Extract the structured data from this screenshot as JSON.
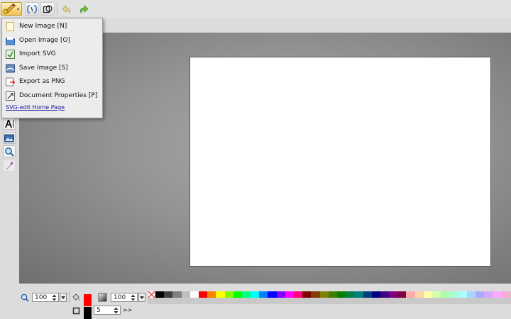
{
  "menu": {
    "items": [
      {
        "label": "New Image [N]",
        "icon": "new-image-icon"
      },
      {
        "label": "Open Image [O]",
        "icon": "open-image-icon"
      },
      {
        "label": "Import SVG",
        "icon": "import-svg-icon"
      },
      {
        "label": "Save Image [S]",
        "icon": "save-image-icon"
      },
      {
        "label": "Export as PNG",
        "icon": "export-png-icon"
      },
      {
        "label": "Document Properties [P]",
        "icon": "document-properties-icon"
      }
    ],
    "home_link": "SVG-edit Home Page"
  },
  "toolbar": {
    "icons": [
      "main-menu-icon",
      "source-icon",
      "wireframe-icon",
      "undo-icon",
      "redo-icon"
    ]
  },
  "bottom": {
    "zoom_value": "100",
    "opacity_value": "100",
    "stroke_width_value": "5",
    "more_label": ">>",
    "fill_color": "#ff0000",
    "stroke_color": "#000000"
  },
  "palette": [
    "#000000",
    "#3f3f3f",
    "#7f7f7f",
    "#bfbfbf",
    "#ffffff",
    "#ff0000",
    "#ff7f00",
    "#ffff00",
    "#7fff00",
    "#00ff00",
    "#00ff7f",
    "#00ffff",
    "#007fff",
    "#0000ff",
    "#7f00ff",
    "#ff00ff",
    "#ff007f",
    "#7f0000",
    "#7f3f00",
    "#7f7f00",
    "#3f7f00",
    "#007f00",
    "#007f3f",
    "#007f7f",
    "#003f7f",
    "#00007f",
    "#3f007f",
    "#7f007f",
    "#7f003f",
    "#ffaaaa",
    "#ffd4aa",
    "#ffffaa",
    "#d4ffaa",
    "#aaffaa",
    "#aaffd4",
    "#aaffff",
    "#aad4ff",
    "#aaaaff",
    "#d4aaff",
    "#ffaaff",
    "#ffaad4"
  ]
}
